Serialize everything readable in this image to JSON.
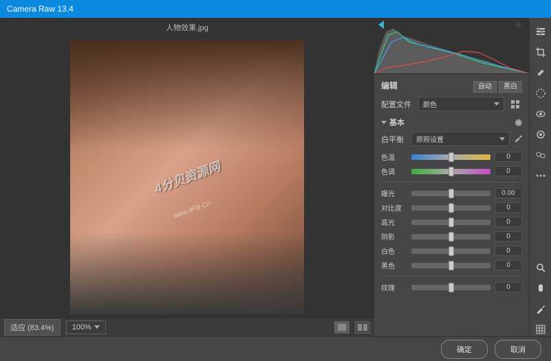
{
  "title": "Camera Raw 13.4",
  "filename": "人物效果.jpg",
  "watermark": "4分贝资源网",
  "watermark_url": "www.4FB.Cn",
  "zoom": {
    "fit_label": "适应 (83.4%)",
    "level": "100%"
  },
  "panel": {
    "edit_label": "编辑",
    "auto_label": "自动",
    "bw_label": "黑白",
    "profile_label": "配置文件",
    "profile_value": "颜色",
    "basic_label": "基本",
    "wb_label": "白平衡",
    "wb_value": "原照设置",
    "sliders": [
      {
        "label": "色温",
        "value": "0",
        "class": "temp"
      },
      {
        "label": "色调",
        "value": "0",
        "class": "tint"
      }
    ],
    "tone_sliders": [
      {
        "label": "曝光",
        "value": "0.00"
      },
      {
        "label": "对比度",
        "value": "0"
      },
      {
        "label": "高光",
        "value": "0"
      },
      {
        "label": "阴影",
        "value": "0"
      },
      {
        "label": "白色",
        "value": "0"
      },
      {
        "label": "黑色",
        "value": "0"
      }
    ],
    "texture_label": "纹理",
    "texture_value": "0"
  },
  "footer": {
    "ok": "确定",
    "cancel": "取消"
  },
  "icons": {
    "edit": "sliders",
    "crop": "crop",
    "heal": "bandage",
    "mask": "mask",
    "redeye": "eye",
    "snapshot": "camera",
    "preset": "preset",
    "zoom": "magnify",
    "hand": "hand",
    "sample": "dropper",
    "grid": "grid"
  }
}
